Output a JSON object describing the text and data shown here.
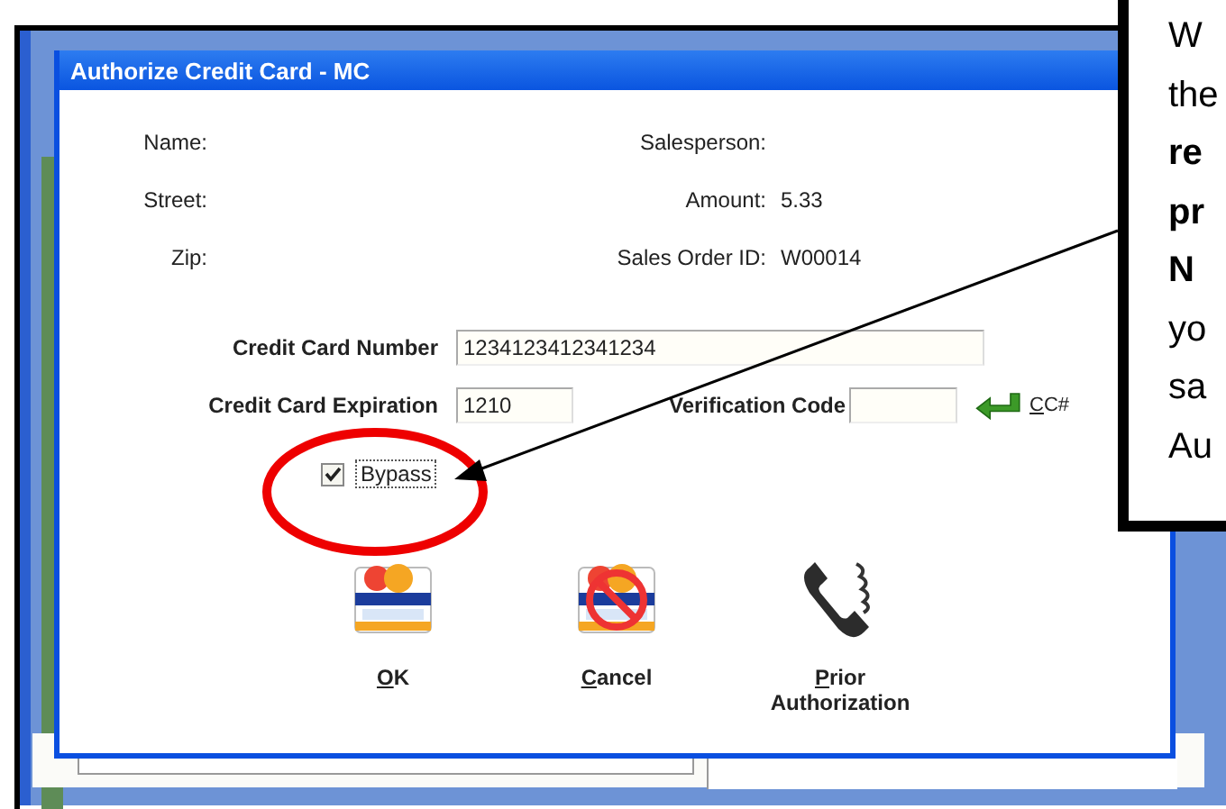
{
  "dialog": {
    "title": "Authorize Credit Card - MC",
    "info_rows": [
      {
        "label": "Name:",
        "right_label": "Salesperson:"
      },
      {
        "label": "Street:",
        "right_label": "Amount:",
        "right_value": "5.33"
      },
      {
        "label": "Zip:",
        "right_label": "Sales Order ID:",
        "right_value": "W00014"
      }
    ],
    "card_number": {
      "label": "Credit Card Number",
      "value": "1234123412341234"
    },
    "expiration": {
      "label": "Credit Card Expiration",
      "value": "1210"
    },
    "verification_code": {
      "label": "Verification Code"
    },
    "cc_link": "CC#",
    "bypass": {
      "label": "Bypass",
      "checked": true
    },
    "buttons": [
      {
        "label": "OK",
        "kind": "visa"
      },
      {
        "label": "Cancel",
        "kind": "cancel"
      },
      {
        "label": "Prior Authorization",
        "kind": "phone"
      }
    ]
  },
  "callout": {
    "lines": [
      {
        "text": "W",
        "bold": false
      },
      {
        "text": "the",
        "bold": false
      },
      {
        "text": "re",
        "bold": true
      },
      {
        "text": "pr",
        "bold": true
      },
      {
        "text": "N",
        "bold": true
      },
      {
        "text": "yo",
        "bold": false
      },
      {
        "text": "sa",
        "bold": false
      },
      {
        "text": "Au",
        "bold": false
      }
    ]
  }
}
